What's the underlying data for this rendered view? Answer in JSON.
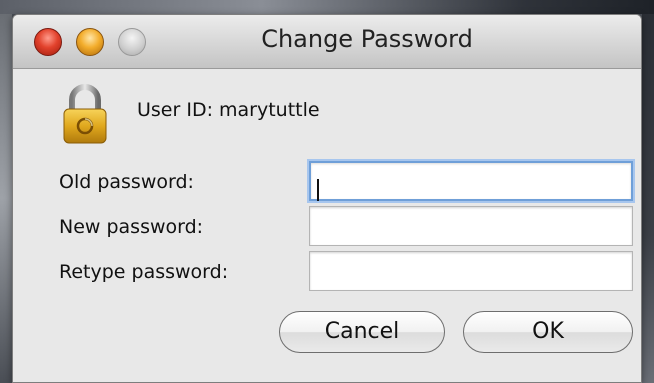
{
  "window": {
    "title": "Change Password"
  },
  "user_id": "User ID: marytuttle",
  "fields": {
    "old": {
      "label": "Old password:",
      "value": ""
    },
    "new": {
      "label": "New password:",
      "value": ""
    },
    "retype": {
      "label": "Retype password:",
      "value": ""
    }
  },
  "buttons": {
    "cancel": "Cancel",
    "ok": "OK"
  }
}
